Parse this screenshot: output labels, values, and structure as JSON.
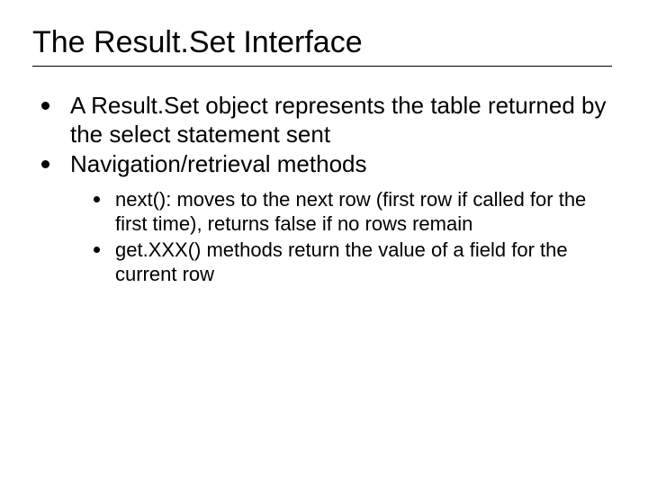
{
  "title": "The Result.Set Interface",
  "bullets": {
    "level1": [
      "A Result.Set object represents the table returned by the select statement sent",
      "Navigation/retrieval methods"
    ],
    "level2": [
      "next():  moves to the next row (first row if called for the first time), returns false if no rows remain",
      "get.XXX() methods return the value of a field for the current row"
    ]
  }
}
